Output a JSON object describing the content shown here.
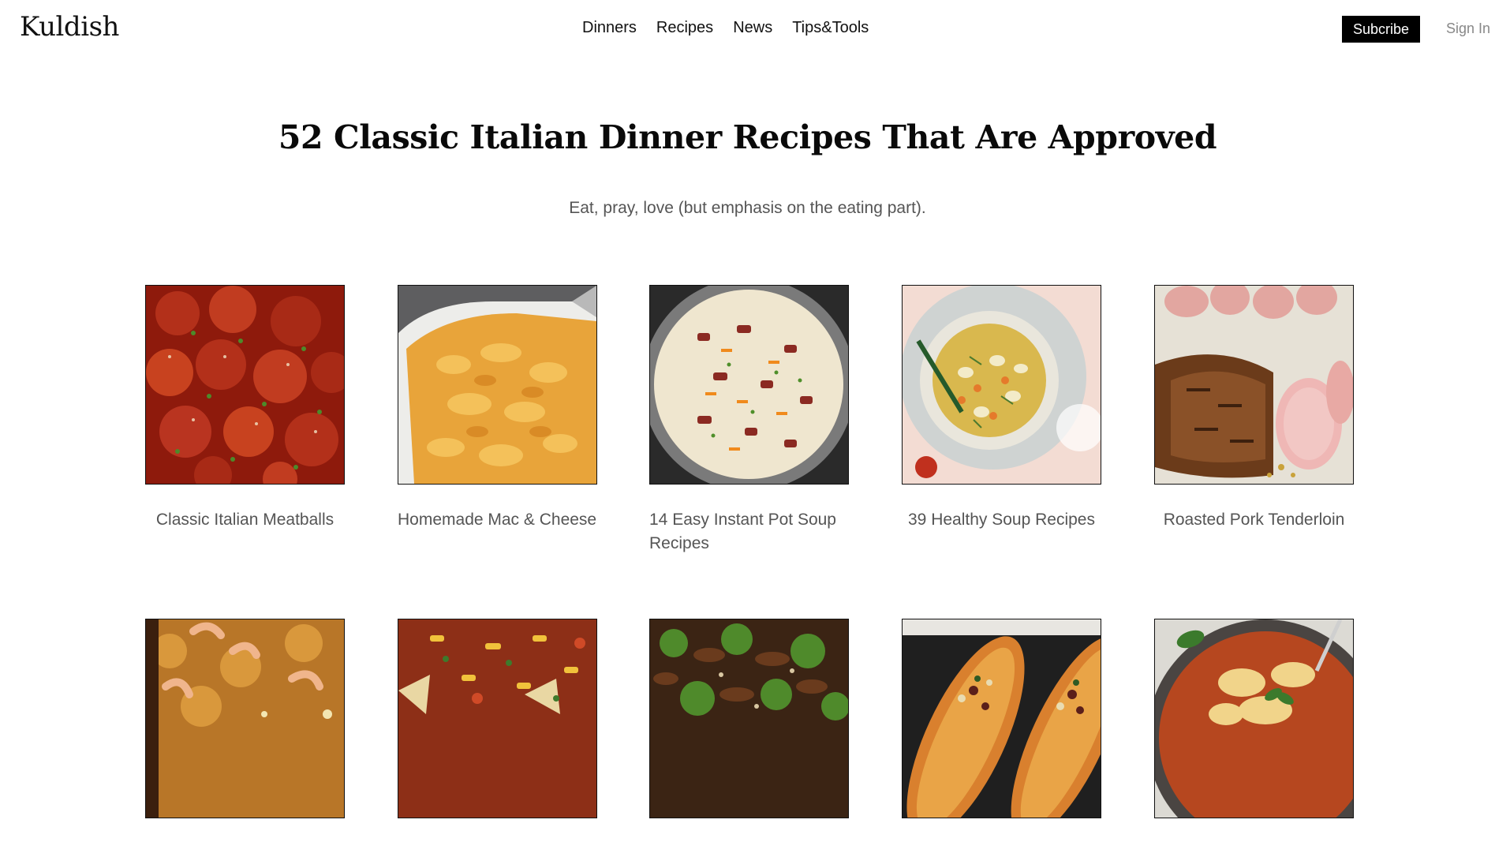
{
  "header": {
    "logo": "Kuldish",
    "nav": [
      "Dinners",
      "Recipes",
      "News",
      "Tips&Tools"
    ],
    "subscribe_label": "Subcribe",
    "signin_label": "Sign In"
  },
  "main": {
    "title": "52 Classic Italian Dinner Recipes That Are Approved",
    "subtitle": "Eat, pray, love (but emphasis on the eating part)."
  },
  "recipes": [
    {
      "title": "Classic Italian Meatballs",
      "image": "meatballs"
    },
    {
      "title": "Homemade Mac & Cheese",
      "image": "mac-and-cheese"
    },
    {
      "title": "14 Easy Instant Pot Soup Recipes",
      "image": "instant-pot-soup"
    },
    {
      "title": "39 Healthy Soup Recipes",
      "image": "healthy-soup"
    },
    {
      "title": "Roasted Pork Tenderloin",
      "image": "pork-tenderloin"
    },
    {
      "title": "",
      "image": "shrimp-paella"
    },
    {
      "title": "",
      "image": "taco-chili"
    },
    {
      "title": "",
      "image": "beef-broccoli"
    },
    {
      "title": "",
      "image": "stuffed-squash"
    },
    {
      "title": "",
      "image": "baked-pasta"
    }
  ],
  "colors": {
    "accent": "#000000",
    "text_muted": "#555555",
    "signin": "#888888"
  }
}
